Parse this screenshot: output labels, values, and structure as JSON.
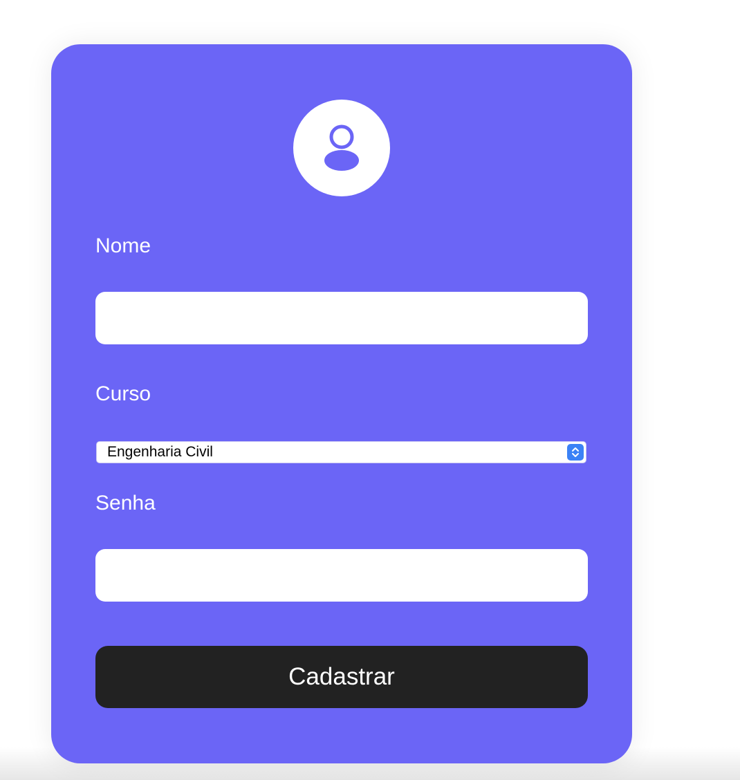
{
  "form": {
    "avatar_icon": "user-icon",
    "accent_color": "#6b65f6",
    "name_label": "Nome",
    "name_value": "",
    "course_label": "Curso",
    "course_selected": "Engenharia Civil",
    "password_label": "Senha",
    "password_value": "",
    "submit_label": "Cadastrar"
  }
}
